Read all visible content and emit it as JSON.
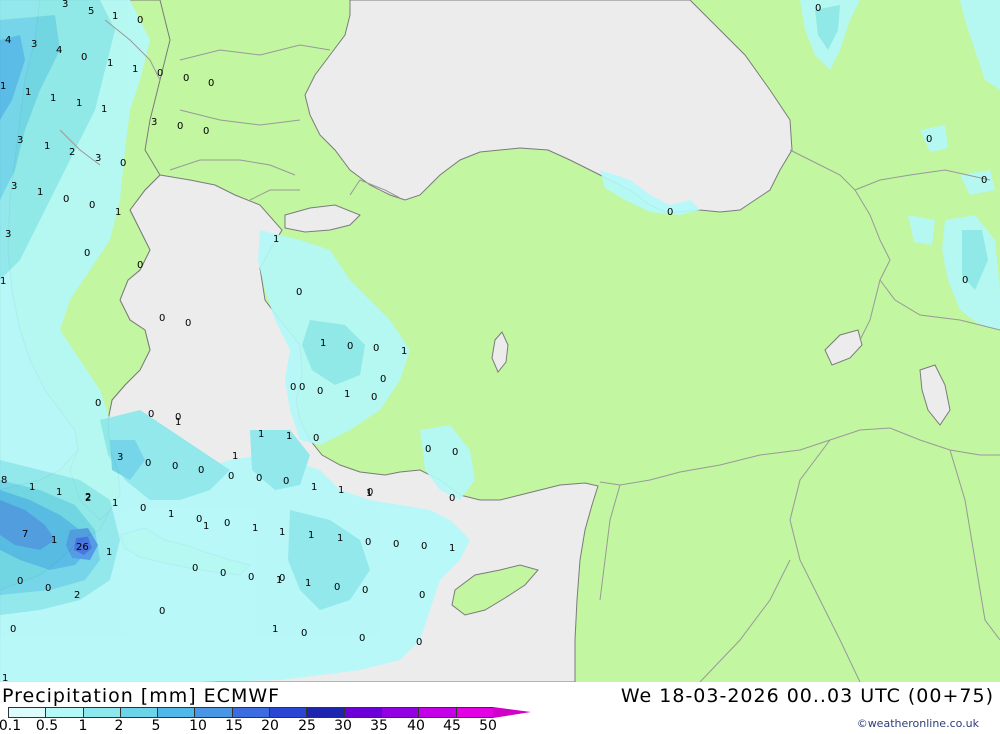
{
  "map": {
    "title": "Precipitation [mm] ECMWF",
    "valid_time": "We 18-03-2026 00..03 UTC (00+75)",
    "credit": "©weatheronline.co.uk",
    "colors": {
      "land": "#c2f6a0",
      "sea": "#ececec",
      "border": "#999999",
      "coast": "#7b7b7b"
    },
    "legend": {
      "values": [
        "0.1",
        "0.5",
        "1",
        "2",
        "5",
        "10",
        "15",
        "20",
        "25",
        "30",
        "35",
        "40",
        "45",
        "50"
      ],
      "colors": [
        "#dcfcfc",
        "#b4f8f8",
        "#8ce8ec",
        "#6cd4e8",
        "#50b8e8",
        "#4896e4",
        "#3c6ce0",
        "#2c46d4",
        "#1c24b0",
        "#6c00d8",
        "#9400e4",
        "#c400e8",
        "#e400e4",
        "#d000c8"
      ]
    },
    "point_values": [
      "3",
      "5",
      "1",
      "0",
      "4",
      "3",
      "4",
      "0",
      "1",
      "1",
      "0",
      "0",
      "0",
      "1",
      "1",
      "1",
      "1",
      "3",
      "0",
      "0",
      "1",
      "3",
      "1",
      "2",
      "3",
      "0",
      "3",
      "1",
      "0",
      "0",
      "1",
      "3",
      "1",
      "0",
      "1",
      "0",
      "0",
      "0",
      "0",
      "1",
      "0",
      "1",
      "0",
      "0",
      "0",
      "1",
      "0",
      "0",
      "0",
      "0",
      "0",
      "0",
      "0",
      "0",
      "1",
      "0",
      "0",
      "1",
      "1",
      "0",
      "3",
      "0",
      "0",
      "1",
      "0",
      "2",
      "1",
      "0",
      "1",
      "1",
      "1",
      "0",
      "0",
      "1",
      "1",
      "1",
      "0",
      "0",
      "8",
      "1",
      "1",
      "2",
      "1",
      "0",
      "1",
      "0",
      "0",
      "1",
      "0",
      "0",
      "7",
      "1",
      "26",
      "1",
      "0",
      "0",
      "1",
      "1",
      "0",
      "0",
      "0",
      "2",
      "0",
      "0",
      "0",
      "1",
      "0",
      "0",
      "0",
      "0",
      "0",
      "0",
      "0",
      "0",
      "0",
      "1",
      "1",
      "0",
      "0"
    ]
  }
}
